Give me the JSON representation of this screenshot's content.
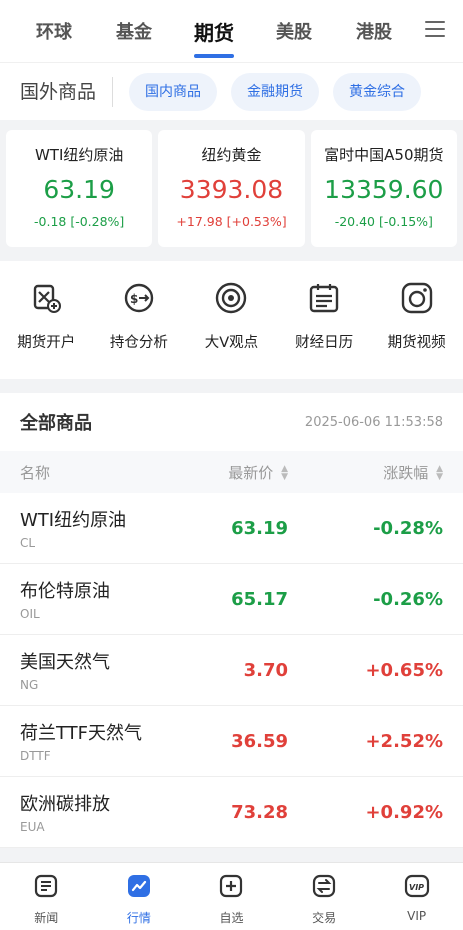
{
  "top_tabs": [
    "环球",
    "基金",
    "期货",
    "美股",
    "港股"
  ],
  "sub": {
    "title": "国外商品",
    "chips": [
      "国内商品",
      "金融期货",
      "黄金综合"
    ]
  },
  "cards": [
    {
      "name": "WTI纽约原油",
      "price": "63.19",
      "change": "-0.18 [-0.28%]",
      "color": "#1c9e47"
    },
    {
      "name": "纽约黄金",
      "price": "3393.08",
      "change": "+17.98 [+0.53%]",
      "color": "#e0403a"
    },
    {
      "name": "富时中国A50期货",
      "price": "13359.60",
      "change": "-20.40 [-0.15%]",
      "color": "#1c9e47"
    }
  ],
  "shortcuts": [
    {
      "label": "期货开户",
      "icon": "account-open-icon"
    },
    {
      "label": "持仓分析",
      "icon": "position-analysis-icon"
    },
    {
      "label": "大V观点",
      "icon": "opinion-icon"
    },
    {
      "label": "财经日历",
      "icon": "calendar-icon"
    },
    {
      "label": "期货视频",
      "icon": "video-icon"
    }
  ],
  "list": {
    "title": "全部商品",
    "time": "2025-06-06 11:53:58",
    "columns": {
      "name": "名称",
      "price": "最新价",
      "change": "涨跌幅"
    },
    "rows": [
      {
        "name": "WTI纽约原油",
        "code": "CL",
        "price": "63.19",
        "change": "-0.28%",
        "color": "#1c9e47"
      },
      {
        "name": "布伦特原油",
        "code": "OIL",
        "price": "65.17",
        "change": "-0.26%",
        "color": "#1c9e47"
      },
      {
        "name": "美国天然气",
        "code": "NG",
        "price": "3.70",
        "change": "+0.65%",
        "color": "#e0403a"
      },
      {
        "name": "荷兰TTF天然气",
        "code": "DTTF",
        "price": "36.59",
        "change": "+2.52%",
        "color": "#e0403a"
      },
      {
        "name": "欧洲碳排放",
        "code": "EUA",
        "price": "73.28",
        "change": "+0.92%",
        "color": "#e0403a"
      }
    ]
  },
  "bottom_nav": [
    {
      "label": "新闻",
      "icon": "news-icon"
    },
    {
      "label": "行情",
      "icon": "market-icon"
    },
    {
      "label": "自选",
      "icon": "watchlist-add-icon"
    },
    {
      "label": "交易",
      "icon": "trade-icon"
    },
    {
      "label": "VIP",
      "icon": "vip-icon"
    }
  ],
  "colors": {
    "accent": "#2f6fe4",
    "up": "#e0403a",
    "down": "#1c9e47"
  }
}
